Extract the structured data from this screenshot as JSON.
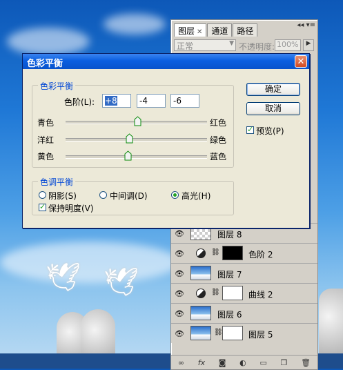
{
  "layers_panel": {
    "tabs": [
      "图层",
      "通道",
      "路径"
    ],
    "blend_mode": "正常",
    "opacity_label": "不透明度:",
    "opacity_value": "100%",
    "layers": [
      {
        "name": "图层 8",
        "thumb": "checker",
        "adjustment": false
      },
      {
        "name": "色阶 2",
        "thumb": "black",
        "adjustment": true
      },
      {
        "name": "图层 7",
        "thumb": "sky",
        "adjustment": false
      },
      {
        "name": "曲线 2",
        "thumb": "white",
        "adjustment": true
      },
      {
        "name": "图层 6",
        "thumb": "sky",
        "adjustment": false
      },
      {
        "name": "图层 5",
        "thumb": "sky",
        "adjustment": false
      }
    ]
  },
  "dialog": {
    "title": "色彩平衡",
    "close_glyph": "✕",
    "color_balance_legend": "色彩平衡",
    "levels_label": "色阶(L):",
    "levels": [
      "+8",
      "-4",
      "-6"
    ],
    "sliders": [
      {
        "left": "青色",
        "right": "红色",
        "value": 8
      },
      {
        "left": "洋红",
        "right": "绿色",
        "value": -4
      },
      {
        "left": "黄色",
        "right": "蓝色",
        "value": -6
      }
    ],
    "tone_legend": "色调平衡",
    "tones": [
      "阴影(S)",
      "中间调(D)",
      "高光(H)"
    ],
    "selected_tone": "高光(H)",
    "preserve_luminosity": "保持明度(V)",
    "ok": "确定",
    "cancel": "取消",
    "preview": "预览(P)"
  }
}
